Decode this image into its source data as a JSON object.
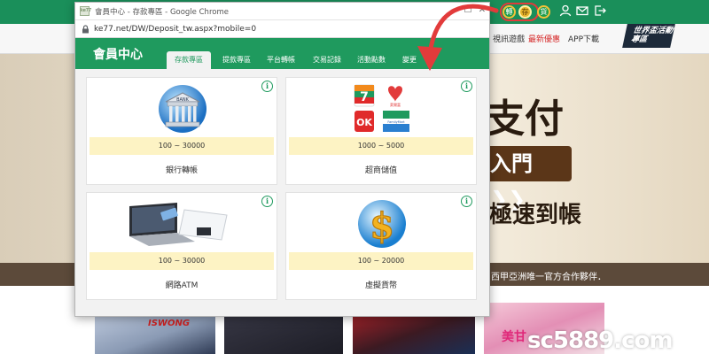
{
  "site": {
    "coins": [
      "轉",
      "存",
      "貨"
    ],
    "nav_links": [
      "視訊遊戲",
      "最新優惠",
      "APP下載"
    ],
    "promo_badge": "世界盃活動專區",
    "hero_pay": "支付",
    "hero_enter": "入門",
    "hero_fast": "極速到帳",
    "footer_text": "西甲亞洲唯一官方合作夥伴．",
    "thumb_labels": [
      "ISWONG",
      "美甘"
    ],
    "watermark": "sc5889.com"
  },
  "window": {
    "title": "會員中心 - 存款專區 - Google Chrome",
    "url": "ke77.net/DW/Deposit_tw.aspx?mobile=0",
    "favicon_text": "ke77"
  },
  "member": {
    "title": "會員中心",
    "tabs": [
      "存款專區",
      "提款專區",
      "平台轉帳",
      "交易記錄",
      "活動點數",
      "變更"
    ],
    "active_tab": 0
  },
  "cards": [
    {
      "range": "100 ~ 30000",
      "label": "銀行轉帳",
      "icon": "bank-icon",
      "art_text": "BANK"
    },
    {
      "range": "1000 ~ 5000",
      "label": "超商儲值",
      "icon": "convenience-store-logos-icon",
      "art_text": [
        "7",
        "OK",
        "FamilyMart",
        "萊爾富"
      ]
    },
    {
      "range": "100 ~ 30000",
      "label": "網路ATM",
      "icon": "laptop-card-reader-icon",
      "art_text": ""
    },
    {
      "range": "100 ~ 20000",
      "label": "虛擬貨幣",
      "icon": "dollar-coin-icon",
      "art_text": "$"
    }
  ],
  "colors": {
    "brand_green": "#1f9a5e",
    "range_bg": "#fdf3c4",
    "annotation_red": "#e23b3b"
  }
}
